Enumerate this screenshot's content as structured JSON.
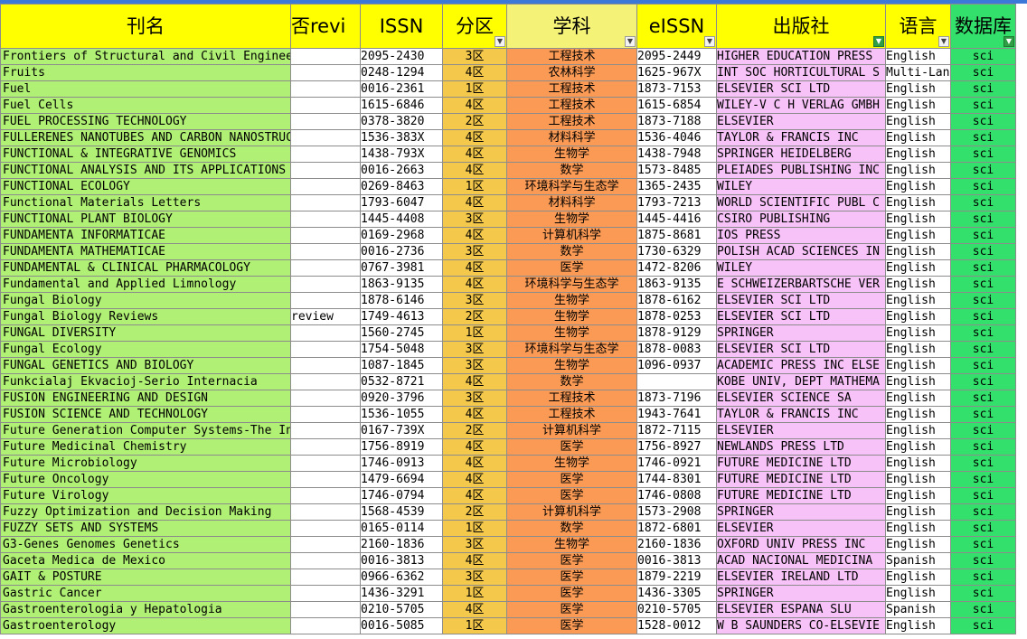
{
  "headers": {
    "title": "刊名",
    "review": "否revi",
    "issn": "ISSN",
    "zone": "分区",
    "subject": "学科",
    "eissn": "eISSN",
    "publisher": "出版社",
    "language": "语言",
    "database": "数据库"
  },
  "colors": {
    "header": "#ffff00",
    "title_col": "#b0f074",
    "zone_col": "#f4c84a",
    "subject_col": "#fa9a55",
    "publisher_col": "#f7c2f7",
    "database_col": "#33e06b"
  },
  "rows": [
    [
      "Frontiers of Structural and Civil Engineering",
      "",
      "2095-2430",
      "3区",
      "工程技术",
      "2095-2449",
      "HIGHER EDUCATION PRESS",
      "English",
      "sci"
    ],
    [
      "Fruits",
      "",
      "0248-1294",
      "4区",
      "农林科学",
      "1625-967X",
      "INT SOC HORTICULTURAL S",
      "Multi-Lan",
      "sci"
    ],
    [
      "Fuel",
      "",
      "0016-2361",
      "1区",
      "工程技术",
      "1873-7153",
      "ELSEVIER SCI LTD",
      "English",
      "sci"
    ],
    [
      "Fuel Cells",
      "",
      "1615-6846",
      "4区",
      "工程技术",
      "1615-6854",
      "WILEY-V C H VERLAG GMBH",
      "English",
      "sci"
    ],
    [
      "FUEL PROCESSING TECHNOLOGY",
      "",
      "0378-3820",
      "2区",
      "工程技术",
      "1873-7188",
      "ELSEVIER",
      "English",
      "sci"
    ],
    [
      "FULLERENES NANOTUBES AND CARBON NANOSTRUCTURES",
      "",
      "1536-383X",
      "4区",
      "材料科学",
      "1536-4046",
      "TAYLOR & FRANCIS INC",
      "English",
      "sci"
    ],
    [
      "FUNCTIONAL & INTEGRATIVE GENOMICS",
      "",
      "1438-793X",
      "4区",
      "生物学",
      "1438-7948",
      "SPRINGER HEIDELBERG",
      "English",
      "sci"
    ],
    [
      "FUNCTIONAL ANALYSIS AND ITS APPLICATIONS",
      "",
      "0016-2663",
      "4区",
      "数学",
      "1573-8485",
      "PLEIADES PUBLISHING INC",
      "English",
      "sci"
    ],
    [
      "FUNCTIONAL ECOLOGY",
      "",
      "0269-8463",
      "1区",
      "环境科学与生态学",
      "1365-2435",
      "WILEY",
      "English",
      "sci"
    ],
    [
      "Functional Materials Letters",
      "",
      "1793-6047",
      "4区",
      "材料科学",
      "1793-7213",
      "WORLD SCIENTIFIC PUBL C",
      "English",
      "sci"
    ],
    [
      "FUNCTIONAL PLANT BIOLOGY",
      "",
      "1445-4408",
      "3区",
      "生物学",
      "1445-4416",
      "CSIRO PUBLISHING",
      "English",
      "sci"
    ],
    [
      "FUNDAMENTA INFORMATICAE",
      "",
      "0169-2968",
      "4区",
      "计算机科学",
      "1875-8681",
      "IOS PRESS",
      "English",
      "sci"
    ],
    [
      "FUNDAMENTA MATHEMATICAE",
      "",
      "0016-2736",
      "3区",
      "数学",
      "1730-6329",
      "POLISH ACAD SCIENCES IN",
      "English",
      "sci"
    ],
    [
      "FUNDAMENTAL & CLINICAL PHARMACOLOGY",
      "",
      "0767-3981",
      "4区",
      "医学",
      "1472-8206",
      "WILEY",
      "English",
      "sci"
    ],
    [
      "Fundamental and Applied Limnology",
      "",
      "1863-9135",
      "4区",
      "环境科学与生态学",
      "1863-9135",
      "E SCHWEIZERBARTSCHE VER",
      "English",
      "sci"
    ],
    [
      "Fungal Biology",
      "",
      "1878-6146",
      "3区",
      "生物学",
      "1878-6162",
      "ELSEVIER SCI LTD",
      "English",
      "sci"
    ],
    [
      "Fungal Biology Reviews",
      "review",
      "1749-4613",
      "2区",
      "生物学",
      "1878-0253",
      "ELSEVIER SCI LTD",
      "English",
      "sci"
    ],
    [
      "FUNGAL DIVERSITY",
      "",
      "1560-2745",
      "1区",
      "生物学",
      "1878-9129",
      "SPRINGER",
      "English",
      "sci"
    ],
    [
      "Fungal Ecology",
      "",
      "1754-5048",
      "3区",
      "环境科学与生态学",
      "1878-0083",
      "ELSEVIER SCI LTD",
      "English",
      "sci"
    ],
    [
      "FUNGAL GENETICS AND BIOLOGY",
      "",
      "1087-1845",
      "3区",
      "生物学",
      "1096-0937",
      "ACADEMIC PRESS INC ELSE",
      "English",
      "sci"
    ],
    [
      "Funkcialaj Ekvacioj-Serio Internacia",
      "",
      "0532-8721",
      "4区",
      "数学",
      "",
      "KOBE UNIV, DEPT MATHEMA",
      "English",
      "sci"
    ],
    [
      "FUSION ENGINEERING AND DESIGN",
      "",
      "0920-3796",
      "3区",
      "工程技术",
      "1873-7196",
      "ELSEVIER SCIENCE SA",
      "English",
      "sci"
    ],
    [
      "FUSION SCIENCE AND TECHNOLOGY",
      "",
      "1536-1055",
      "4区",
      "工程技术",
      "1943-7641",
      "TAYLOR & FRANCIS INC",
      "English",
      "sci"
    ],
    [
      "Future Generation Computer Systems-The Internatio",
      "",
      "0167-739X",
      "2区",
      "计算机科学",
      "1872-7115",
      "ELSEVIER",
      "English",
      "sci"
    ],
    [
      "Future Medicinal Chemistry",
      "",
      "1756-8919",
      "4区",
      "医学",
      "1756-8927",
      "NEWLANDS PRESS LTD",
      "English",
      "sci"
    ],
    [
      "Future Microbiology",
      "",
      "1746-0913",
      "4区",
      "生物学",
      "1746-0921",
      "FUTURE MEDICINE LTD",
      "English",
      "sci"
    ],
    [
      "Future Oncology",
      "",
      "1479-6694",
      "4区",
      "医学",
      "1744-8301",
      "FUTURE MEDICINE LTD",
      "English",
      "sci"
    ],
    [
      "Future Virology",
      "",
      "1746-0794",
      "4区",
      "医学",
      "1746-0808",
      "FUTURE MEDICINE LTD",
      "English",
      "sci"
    ],
    [
      "Fuzzy Optimization and Decision Making",
      "",
      "1568-4539",
      "2区",
      "计算机科学",
      "1573-2908",
      "SPRINGER",
      "English",
      "sci"
    ],
    [
      "FUZZY SETS AND SYSTEMS",
      "",
      "0165-0114",
      "1区",
      "数学",
      "1872-6801",
      "ELSEVIER",
      "English",
      "sci"
    ],
    [
      "G3-Genes Genomes Genetics",
      "",
      "2160-1836",
      "3区",
      "生物学",
      "2160-1836",
      "OXFORD UNIV PRESS INC",
      "English",
      "sci"
    ],
    [
      "Gaceta Medica de Mexico",
      "",
      "0016-3813",
      "4区",
      "医学",
      "0016-3813",
      "ACAD NACIONAL MEDICINA",
      "Spanish",
      "sci"
    ],
    [
      "GAIT & POSTURE",
      "",
      "0966-6362",
      "3区",
      "医学",
      "1879-2219",
      "ELSEVIER IRELAND LTD",
      "English",
      "sci"
    ],
    [
      "Gastric Cancer",
      "",
      "1436-3291",
      "1区",
      "医学",
      "1436-3305",
      "SPRINGER",
      "English",
      "sci"
    ],
    [
      "Gastroenterologia y Hepatologia",
      "",
      "0210-5705",
      "4区",
      "医学",
      "0210-5705",
      "ELSEVIER ESPANA SLU",
      "Spanish",
      "sci"
    ],
    [
      "Gastroenterology",
      "",
      "0016-5085",
      "1区",
      "医学",
      "1528-0012",
      "W B SAUNDERS CO-ELSEVIE",
      "English",
      "sci"
    ]
  ]
}
